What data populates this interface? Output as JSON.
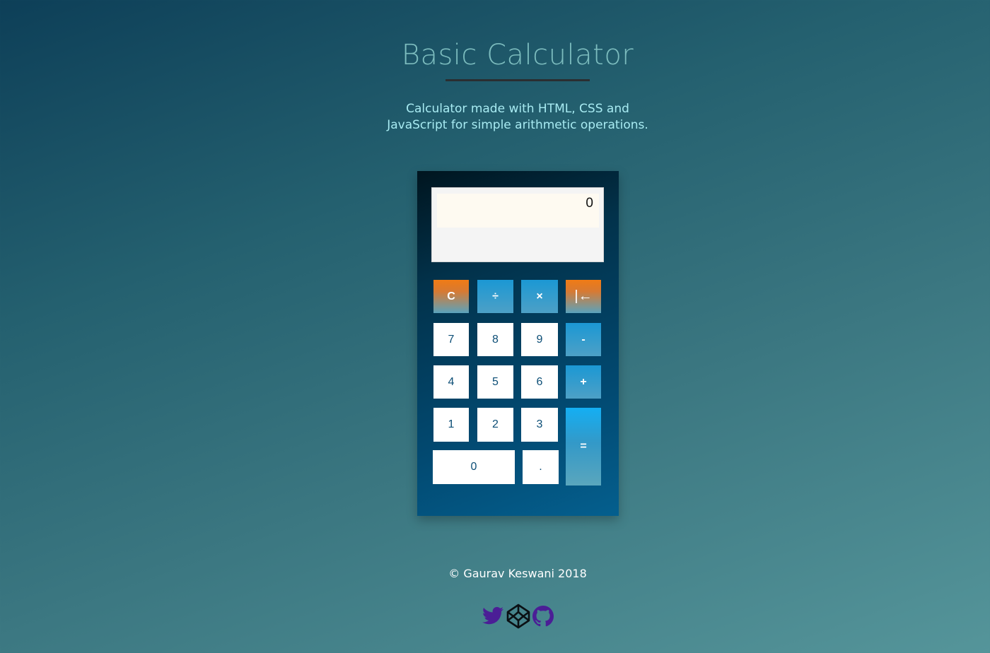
{
  "page": {
    "title": "Basic Calculator",
    "subtitle": "Calculator made with HTML, CSS and JavaScript for simple arithmetic operations."
  },
  "calculator": {
    "display": "0",
    "keys": {
      "clear": "C",
      "divide": "÷",
      "multiply": "×",
      "backspace": "|←",
      "seven": "7",
      "eight": "8",
      "nine": "9",
      "minus": "-",
      "four": "4",
      "five": "5",
      "six": "6",
      "plus": "+",
      "one": "1",
      "two": "2",
      "three": "3",
      "equals": "=",
      "zero": "0",
      "decimal": "."
    }
  },
  "footer": {
    "copyright": "© Gaurav Keswani 2018"
  },
  "social_icons": [
    "twitter-icon",
    "codepen-icon",
    "github-icon"
  ],
  "colors": {
    "accent_orange": "#f07b15",
    "accent_blue": "#1b98d4",
    "key_text": "#0c4e76",
    "title": "#7cbcbe",
    "subtitle": "#a8ebf2",
    "social_icon": "#4b1e96"
  }
}
